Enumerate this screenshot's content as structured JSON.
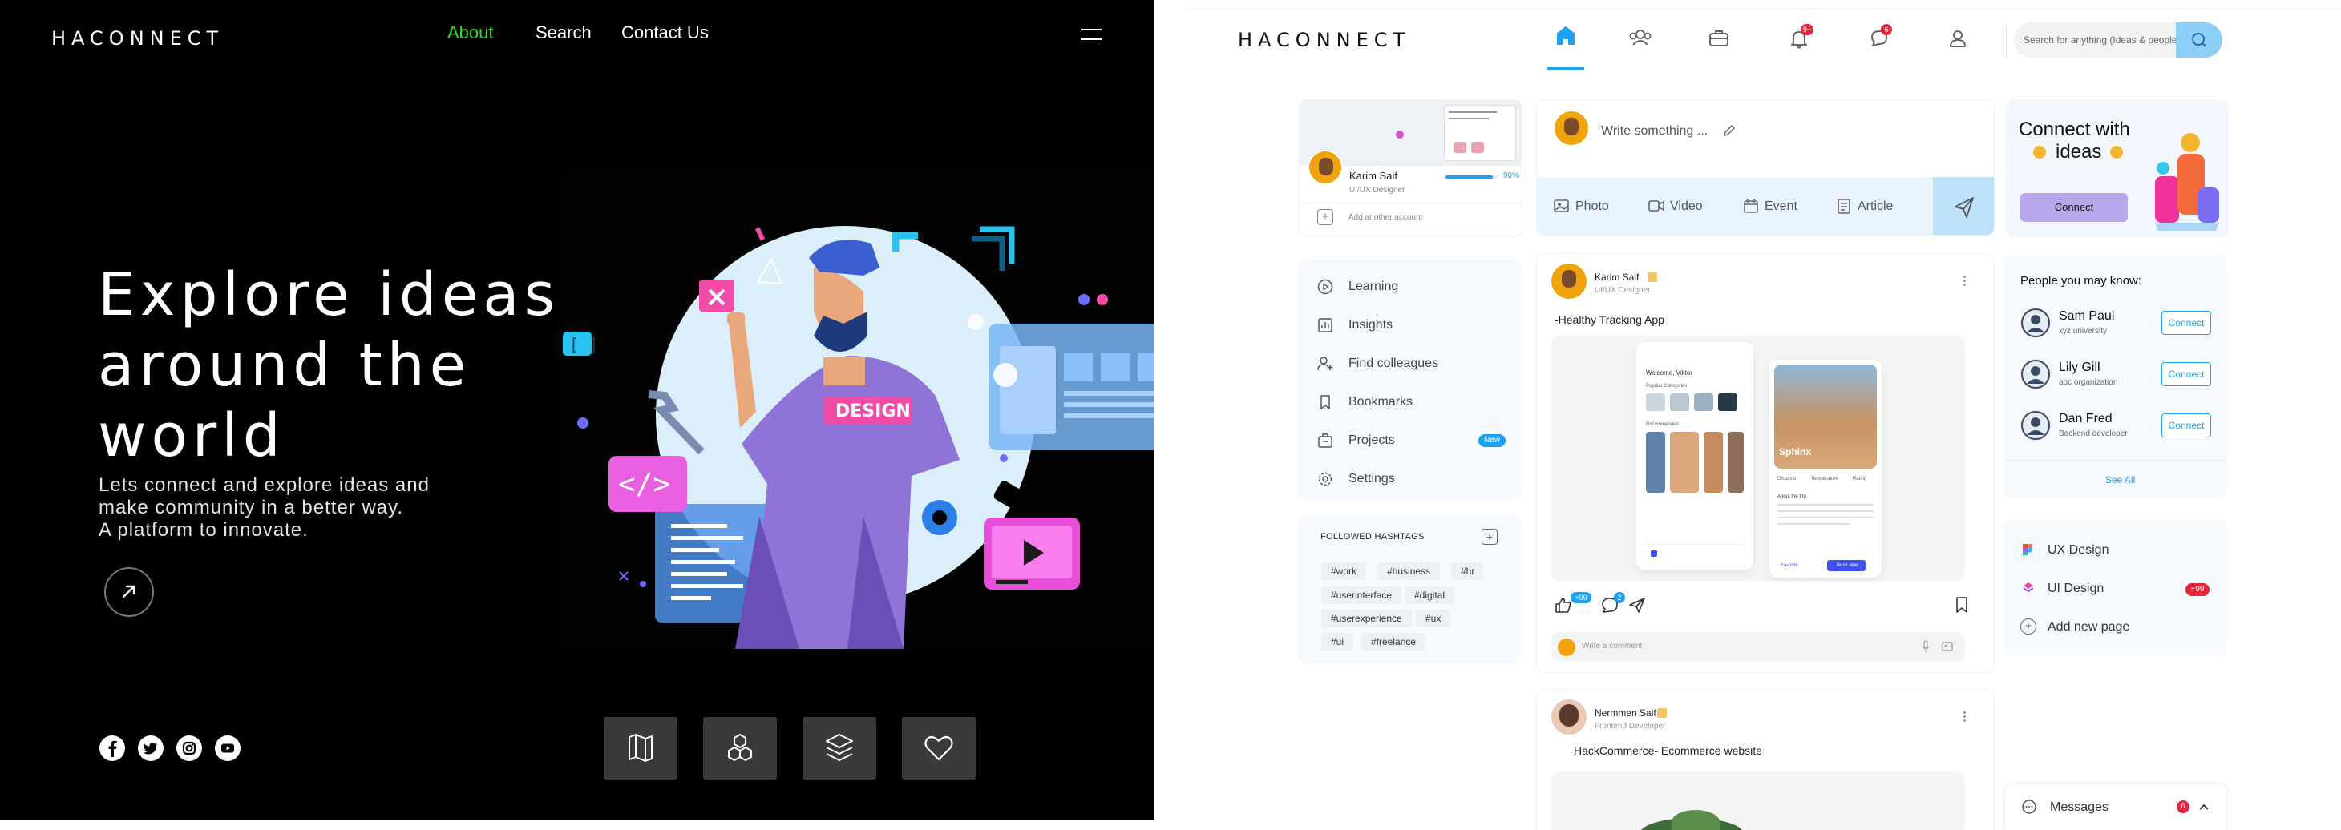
{
  "left": {
    "logo": "HACONNECT",
    "nav": {
      "about": "About",
      "search": "Search",
      "contact": "Contact Us"
    },
    "hero_lines": [
      "Explore ideas",
      "around the",
      "world"
    ],
    "sub_lines": [
      "Lets connect and explore ideas and",
      "make community in a better way.",
      "A platform to innovate."
    ],
    "illustration_text": "DESIGN",
    "colors": {
      "accent": "#39d928",
      "bg": "#000000"
    },
    "social_icons": [
      "facebook-icon",
      "twitter-icon",
      "instagram-icon",
      "youtube-icon"
    ],
    "bottom_icons": [
      "map-icon",
      "boxes-icon",
      "layers-icon",
      "heart-icon"
    ]
  },
  "right": {
    "logo": "HACONNECT",
    "nav_icons": [
      "home-icon",
      "users-icon",
      "briefcase-icon",
      "bell-icon",
      "chat-icon",
      "profile-icon"
    ],
    "badges": {
      "notifications": "9+",
      "messages": "6"
    },
    "search_placeholder": "Search for anything (Ideas & people)",
    "profile": {
      "name": "Karim Saif",
      "role": "UI/UX Designer",
      "progress_label": "90%",
      "progress": 0.9,
      "add_account": "Add another account"
    },
    "composer": {
      "placeholder": "Write something ...",
      "actions": [
        "Photo",
        "Video",
        "Event",
        "Article"
      ]
    },
    "promo": {
      "title_1": "Connect with",
      "title_2": "ideas",
      "button": "Connect"
    },
    "menu": [
      {
        "label": "Learning",
        "icon": "play-icon"
      },
      {
        "label": "Insights",
        "icon": "chart-icon"
      },
      {
        "label": "Find colleagues",
        "icon": "user-add-icon"
      },
      {
        "label": "Bookmarks",
        "icon": "bookmark-icon"
      },
      {
        "label": "Projects",
        "icon": "projects-icon",
        "badge": "New"
      },
      {
        "label": "Settings",
        "icon": "settings-icon"
      }
    ],
    "hashtags": {
      "title": "FOLLOWED HASHTAGS",
      "tags": [
        "#work",
        "#business",
        "#hr",
        "#userinterface",
        "#digital",
        "#userexperience",
        "#ux",
        "#ui",
        "#freelance"
      ]
    },
    "post1": {
      "author": "Karim Saif",
      "role": "UI/UX Designer",
      "text": "-Healthy Tracking App",
      "likes": "+99",
      "comments": "2",
      "comment_placeholder": "Write a comment",
      "screen_a": {
        "welcome": "Welcome, Viktor",
        "section": "Popular Categories",
        "rec": "Recommended"
      },
      "screen_b": {
        "title": "Sphinx",
        "stats": [
          "Distance",
          "Temperature",
          "Rating"
        ],
        "about": "About the trip",
        "buttons": [
          "Favorite",
          "Book Now"
        ]
      }
    },
    "post2": {
      "author": "Nermmen Saif",
      "role": "Frontend Developer",
      "text": "HackCommerce- Ecommerce website"
    },
    "people": {
      "title": "People you may know:",
      "list": [
        {
          "name": "Sam Paul",
          "org": "xyz university",
          "button": "Connect"
        },
        {
          "name": "Lily Gill",
          "org": "abc organization",
          "button": "Connect"
        },
        {
          "name": "Dan Fred",
          "org": "Backend developer",
          "button": "Connect"
        }
      ],
      "see_all": "See All"
    },
    "pages": [
      {
        "label": "UX Design"
      },
      {
        "label": "UI Design",
        "badge": "+99"
      },
      {
        "label": "Add new page"
      }
    ],
    "messages": {
      "label": "Messages",
      "badge": "6"
    },
    "colors": {
      "accent": "#1da1f2",
      "alert": "#e8253b",
      "new_badge": "#1da1f2"
    }
  }
}
